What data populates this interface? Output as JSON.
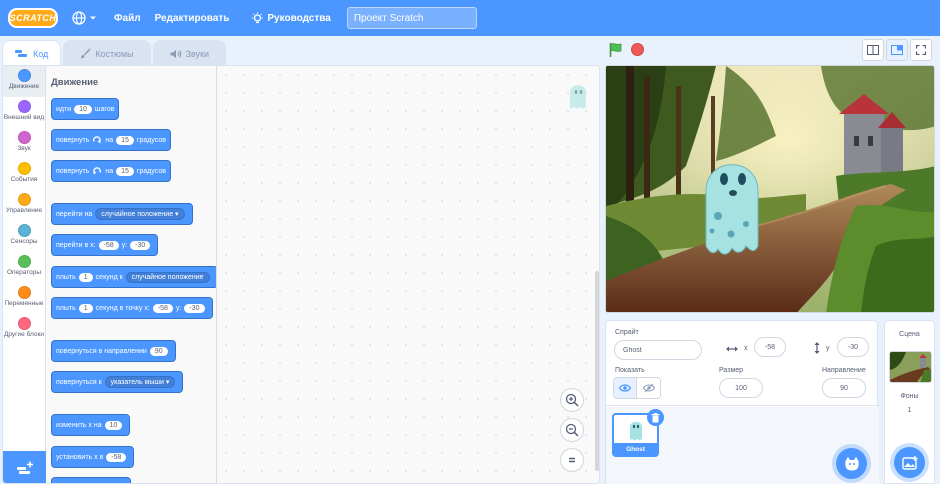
{
  "menubar": {
    "logo": "SCRATCH",
    "file": "Файл",
    "edit": "Редактировать",
    "tutorials": "Руководства",
    "project_title": "Проект Scratch"
  },
  "tabs": [
    {
      "label": "Код",
      "icon": "code-icon",
      "active": true
    },
    {
      "label": "Костюмы",
      "icon": "brush-icon",
      "active": false
    },
    {
      "label": "Звуки",
      "icon": "speaker-icon",
      "active": false
    }
  ],
  "categories": [
    {
      "label": "Движение",
      "color": "#4c97ff",
      "active": true
    },
    {
      "label": "Внешний вид",
      "color": "#9966ff"
    },
    {
      "label": "Звук",
      "color": "#cf63cf"
    },
    {
      "label": "События",
      "color": "#ffbf00"
    },
    {
      "label": "Управление",
      "color": "#ffab19"
    },
    {
      "label": "Сенсоры",
      "color": "#5cb1d6"
    },
    {
      "label": "Операторы",
      "color": "#59c059"
    },
    {
      "label": "Переменные",
      "color": "#ff8c1a"
    },
    {
      "label": "Другие блоки",
      "color": "#ff6680"
    }
  ],
  "palette": {
    "title": "Движение",
    "blocks": {
      "move": {
        "a": "идти",
        "n": "10",
        "b": "шагов"
      },
      "turn_right": {
        "a": "повернуть",
        "b": "на",
        "n": "15",
        "c": "градусов"
      },
      "turn_left": {
        "a": "повернуть",
        "b": "на",
        "n": "15",
        "c": "градусов"
      },
      "goto": {
        "a": "перейти на",
        "d": "случайное положение"
      },
      "goto_xy": {
        "a": "перейти в x:",
        "x": "-58",
        "b": "y:",
        "y": "-30"
      },
      "glide": {
        "a": "плыть",
        "n": "1",
        "b": "секунд к",
        "d": "случайное положение"
      },
      "glide_xy": {
        "a": "плыть",
        "n": "1",
        "b": "секунд в точку x:",
        "x": "-58",
        "c": "y:",
        "y": "-30"
      },
      "point_dir": {
        "a": "повернуться в направлении",
        "n": "90"
      },
      "point_towards": {
        "a": "повернуться к",
        "d": "указатель мыши"
      },
      "change_x": {
        "a": "изменить х на",
        "n": "10"
      },
      "set_x": {
        "a": "установить х в",
        "n": "-58"
      }
    }
  },
  "sprite_info": {
    "sprite_label": "Спрайт",
    "sprite_name": "Ghost",
    "x_label": "x",
    "x_value": "-58",
    "y_label": "y",
    "y_value": "-30",
    "show_label": "Показать",
    "size_label": "Размер",
    "size_value": "100",
    "direction_label": "Направление",
    "direction_value": "90"
  },
  "sprites": [
    {
      "name": "Ghost",
      "selected": true
    }
  ],
  "stage_panel": {
    "title": "Сцена",
    "backdrops_label": "Фоны",
    "backdrops_count": "1"
  },
  "colors": {
    "menubar": "#4c97ff",
    "motion": "#4c97ff",
    "stop": "#ec5959",
    "flag": "#4cbf56"
  }
}
